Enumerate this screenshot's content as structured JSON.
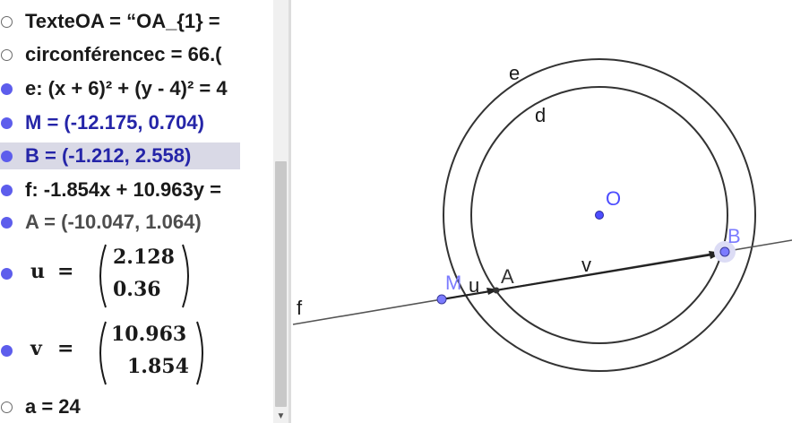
{
  "algebra": {
    "rows": [
      {
        "text": "TexteOA = “OA_{1} =",
        "marker": "empty",
        "color": "black"
      },
      {
        "text": "circonférencec = 66.(",
        "marker": "empty",
        "color": "black"
      },
      {
        "text": "e: (x + 6)² + (y - 4)² = 4",
        "marker": "filled",
        "color": "black"
      },
      {
        "text": "M = (-12.175, 0.704)",
        "marker": "filled",
        "color": "blue"
      },
      {
        "text": "B = (-1.212, 2.558)",
        "marker": "filled",
        "color": "blue",
        "selected": true
      },
      {
        "text": "f: -1.854x + 10.963y =",
        "marker": "filled",
        "color": "black"
      },
      {
        "text": "A = (-10.047, 1.064)",
        "marker": "filled",
        "color": "gray"
      }
    ],
    "vectors": [
      {
        "name": "u",
        "eq": "=",
        "x": "2.128",
        "y": "0.36"
      },
      {
        "name": "v",
        "eq": "=",
        "x": "10.963",
        "y": "1.854"
      }
    ],
    "last_row": {
      "text": "a = 24",
      "marker": "empty"
    }
  },
  "graphics": {
    "labels": {
      "e": "e",
      "d": "d",
      "O": "O",
      "B": "B",
      "M": "M",
      "u": "u",
      "A": "A",
      "v": "v",
      "f": "f"
    },
    "colors": {
      "point": "#4d4dff",
      "point_label": "#7b7bff",
      "curve": "#333333"
    }
  }
}
